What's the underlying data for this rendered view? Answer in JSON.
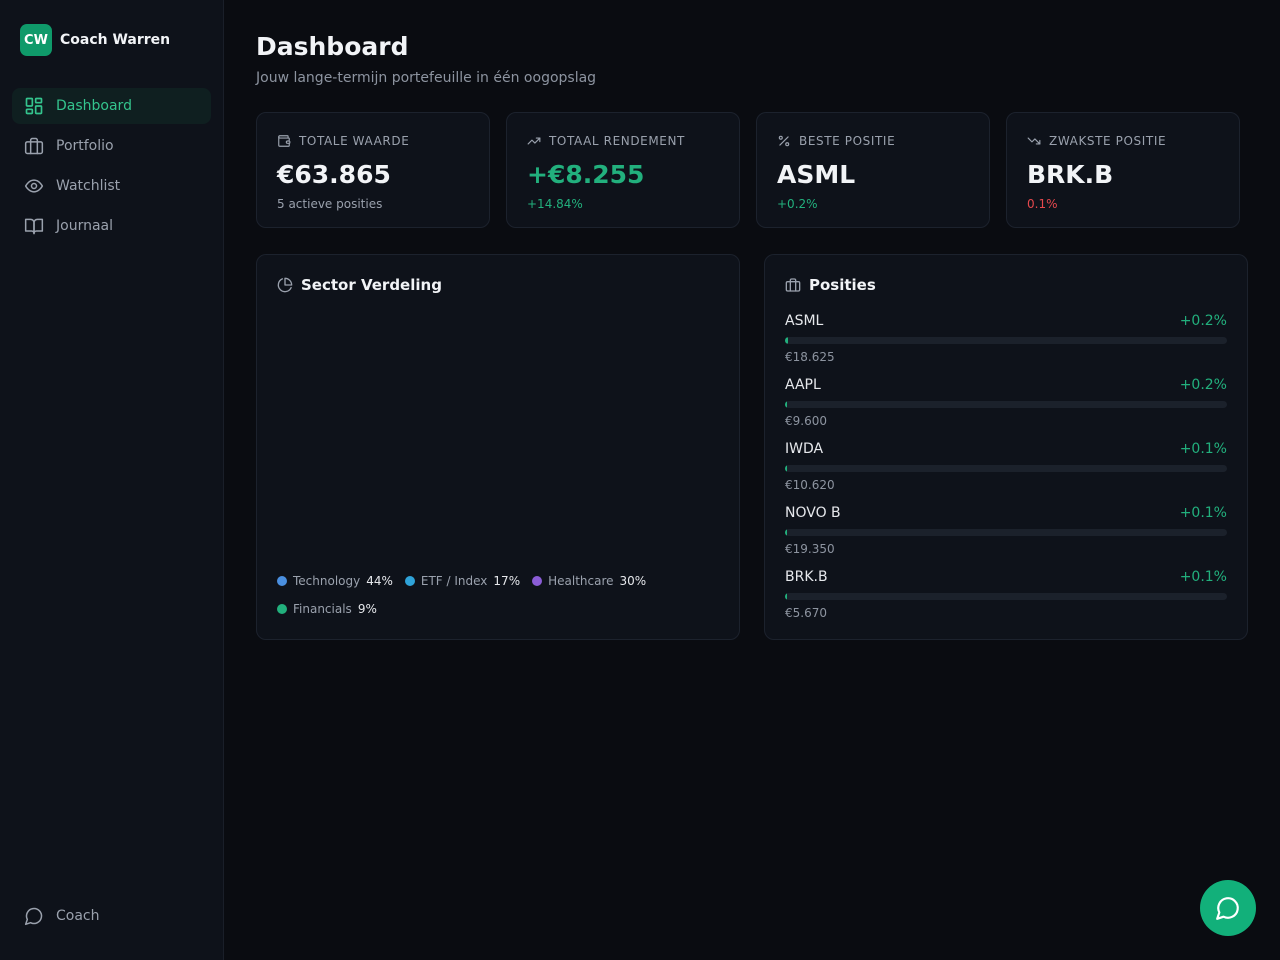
{
  "brand": {
    "logo_text": "CW",
    "name": "Coach Warren"
  },
  "sidebar": {
    "items": [
      {
        "label": "Dashboard",
        "icon": "dashboard-icon",
        "active": true
      },
      {
        "label": "Portfolio",
        "icon": "briefcase-icon"
      },
      {
        "label": "Watchlist",
        "icon": "eye-icon"
      },
      {
        "label": "Journaal",
        "icon": "book-icon"
      }
    ],
    "coach_label": "Coach"
  },
  "header": {
    "title": "Dashboard",
    "subtitle": "Jouw lange-termijn portefeuille in één oogopslag"
  },
  "stats": [
    {
      "label": "TOTALE WAARDE",
      "icon": "wallet-icon",
      "value": "€63.865",
      "sub": "5 actieve posities"
    },
    {
      "label": "TOTAAL RENDEMENT",
      "icon": "trending-up-icon",
      "value": "+€8.255",
      "sub": "+14.84%"
    },
    {
      "label": "BESTE POSITIE",
      "icon": "percent-icon",
      "value": "ASML",
      "sub": "+0.2%"
    },
    {
      "label": "ZWAKSTE POSITIE",
      "icon": "trending-down-icon",
      "value": "BRK.B",
      "sub": "0.1%"
    }
  ],
  "sector_panel": {
    "title": "Sector Verdeling",
    "legend": [
      {
        "name": "Technology",
        "pct": "44%",
        "color": "#4a8fe0"
      },
      {
        "name": "ETF / Index",
        "pct": "17%",
        "color": "#2fa3d9"
      },
      {
        "name": "Healthcare",
        "pct": "30%",
        "color": "#8a5cd6"
      },
      {
        "name": "Financials",
        "pct": "9%",
        "color": "#22b07d"
      }
    ]
  },
  "positions_panel": {
    "title": "Posities",
    "items": [
      {
        "name": "ASML",
        "change": "+0.2%",
        "value": "€18.625",
        "level": 0.006
      },
      {
        "name": "AAPL",
        "change": "+0.2%",
        "value": "€9.600",
        "level": 0.005
      },
      {
        "name": "IWDA",
        "change": "+0.1%",
        "value": "€10.620",
        "level": 0.004
      },
      {
        "name": "NOVO B",
        "change": "+0.1%",
        "value": "€19.350",
        "level": 0.003
      },
      {
        "name": "BRK.B",
        "change": "+0.1%",
        "value": "€5.670",
        "level": 0.003
      }
    ]
  },
  "colors": {
    "accent": "#22b07d",
    "negative": "#e5484d",
    "brand": "#0f9a6a"
  }
}
